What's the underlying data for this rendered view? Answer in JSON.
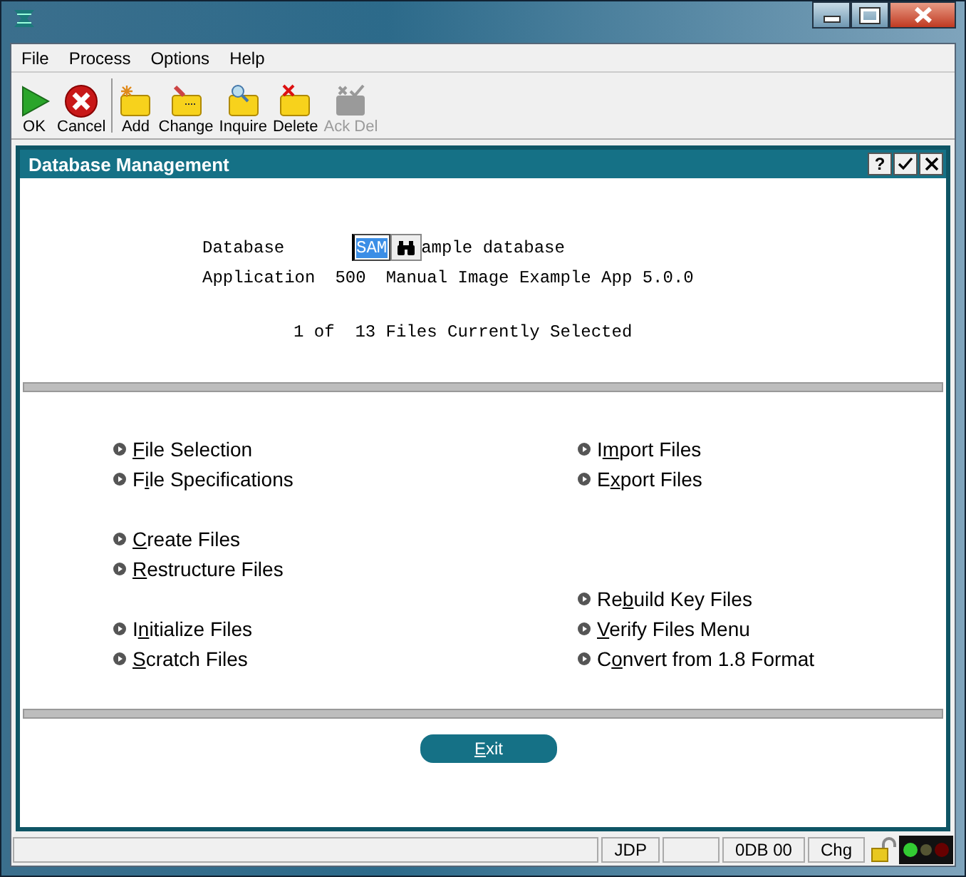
{
  "menu": [
    "File",
    "Process",
    "Options",
    "Help"
  ],
  "toolbar": [
    {
      "label": "OK",
      "kind": "ok",
      "disabled": false
    },
    {
      "label": "Cancel",
      "kind": "cancel",
      "disabled": false
    },
    {
      "label": "Add",
      "kind": "add",
      "disabled": false
    },
    {
      "label": "Change",
      "kind": "change",
      "disabled": false
    },
    {
      "label": "Inquire",
      "kind": "inquire",
      "disabled": false
    },
    {
      "label": "Delete",
      "kind": "delete",
      "disabled": false
    },
    {
      "label": "Ack Del",
      "kind": "ackdel",
      "disabled": true
    }
  ],
  "panel": {
    "title": "Database Management",
    "help": "?"
  },
  "database": {
    "label": "Database",
    "value": "SAM",
    "description": "ample database"
  },
  "application": {
    "label": "Application",
    "number": "500",
    "description": "Manual Image Example App 5.0.0"
  },
  "selected_count": "1 of  13 Files Currently Selected",
  "rows": [
    {
      "left": {
        "key": "F",
        "post": "ile Selection"
      },
      "right": {
        "pre": "I",
        "key": "m",
        "post": "port Files"
      }
    },
    {
      "left": {
        "pre": "F",
        "key": "i",
        "post": "le Specifications"
      },
      "right": {
        "pre": "E",
        "key": "x",
        "post": "port Files"
      }
    },
    {},
    {
      "left": {
        "key": "C",
        "post": "reate Files"
      }
    },
    {
      "left": {
        "key": "R",
        "post": "estructure Files"
      }
    },
    {
      "right": {
        "pre": "Re",
        "key": "b",
        "post": "uild Key Files"
      }
    },
    {
      "left": {
        "pre": "I",
        "key": "n",
        "post": "itialize Files"
      },
      "right": {
        "key": "V",
        "post": "erify Files Menu"
      }
    },
    {
      "left": {
        "key": "S",
        "post": "cratch Files"
      },
      "right": {
        "pre": "C",
        "key": "o",
        "post": "nvert from 1.8 Format"
      }
    }
  ],
  "exit": {
    "key": "E",
    "post": "xit"
  },
  "status": [
    "JDP",
    "0DB 00",
    "Chg"
  ]
}
